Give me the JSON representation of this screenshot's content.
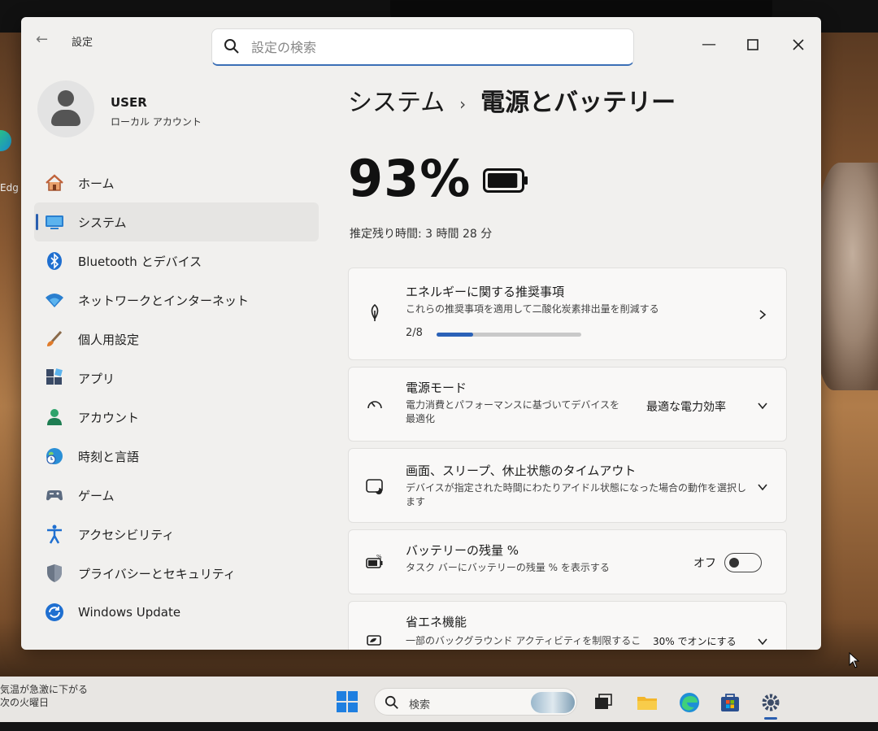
{
  "window": {
    "app_title": "設定",
    "search_placeholder": "設定の検索"
  },
  "user": {
    "name": "USER",
    "account_type": "ローカル アカウント"
  },
  "sidebar": {
    "items": [
      {
        "label": "ホーム",
        "icon": "home-icon"
      },
      {
        "label": "システム",
        "icon": "system-icon",
        "active": true
      },
      {
        "label": "Bluetooth とデバイス",
        "icon": "bluetooth-icon"
      },
      {
        "label": "ネットワークとインターネット",
        "icon": "wifi-icon"
      },
      {
        "label": "個人用設定",
        "icon": "brush-icon"
      },
      {
        "label": "アプリ",
        "icon": "apps-icon"
      },
      {
        "label": "アカウント",
        "icon": "account-icon"
      },
      {
        "label": "時刻と言語",
        "icon": "globe-clock-icon"
      },
      {
        "label": "ゲーム",
        "icon": "gamepad-icon"
      },
      {
        "label": "アクセシビリティ",
        "icon": "accessibility-icon"
      },
      {
        "label": "プライバシーとセキュリティ",
        "icon": "shield-icon"
      },
      {
        "label": "Windows Update",
        "icon": "update-icon"
      }
    ]
  },
  "main": {
    "breadcrumb_parent": "システム",
    "breadcrumb_separator": "›",
    "breadcrumb_current": "電源とバッテリー",
    "battery_percent": "93%",
    "battery_level": 0.93,
    "remaining_time": "推定残り時間: 3 時間 28 分",
    "cards": {
      "energy": {
        "title": "エネルギーに関する推奨事項",
        "desc": "これらの推奨事項を適用して二酸化炭素排出量を削減する",
        "progress_label": "2/8",
        "progress_fraction": 0.25
      },
      "power_mode": {
        "title": "電源モード",
        "desc": "電力消費とパフォーマンスに基づいてデバイスを最適化",
        "value": "最適な電力効率"
      },
      "screen_sleep": {
        "title": "画面、スリープ、休止状態のタイムアウト",
        "desc": "デバイスが指定された時間にわたりアイドル状態になった場合の動作を選択します"
      },
      "battery_pct": {
        "title": "バッテリーの残量 %",
        "desc": "タスク バーにバッテリーの残量 % を表示する",
        "value": "オフ"
      },
      "saver": {
        "title": "省エネ機能",
        "desc": "一部のバックグラウンド アクティビティを制限すること",
        "value": "30% でオンにする"
      }
    }
  },
  "desktop": {
    "edge_label": "Edg"
  },
  "taskbar": {
    "weather_line1": "気温が急激に下がる",
    "weather_line2": "次の火曜日",
    "search_label": "検索"
  },
  "colors": {
    "accent": "#2b62b8",
    "window_bg": "#f1f0ee",
    "card_bg": "#f9f8f7"
  }
}
